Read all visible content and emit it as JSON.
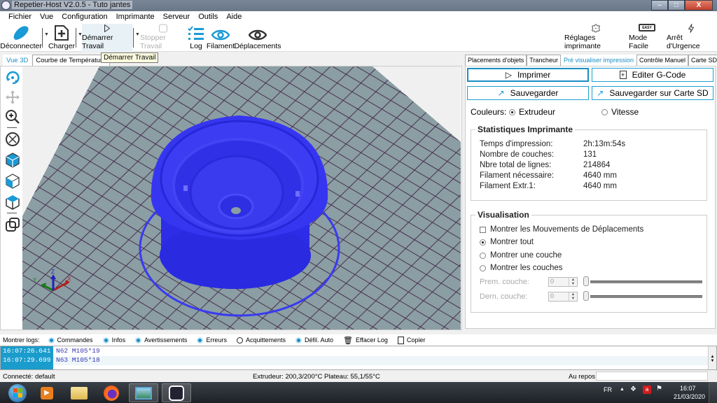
{
  "window": {
    "title": "Repetier-Host V2.0.5 - Tuto jantes",
    "controls": {
      "minimize": "–",
      "maximize": "□",
      "close": "X"
    }
  },
  "menu": [
    "Fichier",
    "Vue",
    "Configuration",
    "Imprimante",
    "Serveur",
    "Outils",
    "Aide"
  ],
  "toolbar": {
    "disconnect": "Déconnecter",
    "load": "Charger",
    "start_job": "Démarrer Travail",
    "stop_job": "Stopper Travail",
    "log": "Log",
    "filament": "Filament",
    "moves": "Déplacements",
    "printer_settings": "Réglages imprimante",
    "easy_mode": "Mode Facile",
    "easy_badge": "EASY",
    "emergency_stop": "Arrêt d'Urgence"
  },
  "tooltip": "Démarrer Travail",
  "left_tabs": [
    "Vue 3D",
    "Courbe de Température"
  ],
  "right_tabs": [
    "Placements d'objets",
    "Trancheur",
    "Pré visualiser impression",
    "Contrôle Manuel",
    "Carte SD"
  ],
  "preview": {
    "print_button": "Imprimer",
    "edit_gcode_button": "Editer G-Code",
    "save_button": "Sauvegarder",
    "save_sd_button": "Sauvegarder sur Carte SD",
    "colors_label": "Couleurs:",
    "color_options": [
      {
        "label": "Extrudeur",
        "selected": true
      },
      {
        "label": "Vitesse",
        "selected": false
      }
    ],
    "stats": {
      "title": "Statistiques Imprimante",
      "rows": [
        {
          "label": "Temps d'impression:",
          "value": "2h:13m:54s"
        },
        {
          "label": "Nombre de couches:",
          "value": "131"
        },
        {
          "label": "Nbre total de lignes:",
          "value": "214864"
        },
        {
          "label": "Filament nécessaire:",
          "value": "4640 mm"
        },
        {
          "label": "Filament Extr.1:",
          "value": "4640 mm"
        }
      ]
    },
    "visualisation": {
      "title": "Visualisation",
      "show_travel": {
        "label": "Montrer les Mouvements de Déplacements",
        "checked": false
      },
      "modes": [
        {
          "label": "Montrer tout",
          "selected": true
        },
        {
          "label": "Montrer une couche",
          "selected": false
        },
        {
          "label": "Montrer les couches",
          "selected": false
        }
      ],
      "first_layer": {
        "label": "Prem. couche:",
        "value": "0",
        "slider_fraction": 0
      },
      "last_layer": {
        "label": "Dern. couche:",
        "value": "0",
        "slider_fraction": 0
      }
    }
  },
  "viewport": {
    "object_color": "#3a3af0",
    "bed_color": "#8a9ea3",
    "axis_labels": {
      "x": "X",
      "y": "Y",
      "z": "Z"
    }
  },
  "log_options": {
    "label": "Montrer logs:",
    "items": [
      {
        "label": "Commandes",
        "on": true
      },
      {
        "label": "Infos",
        "on": true
      },
      {
        "label": "Avertissements",
        "on": true
      },
      {
        "label": "Erreurs",
        "on": true
      },
      {
        "label": "Acquittements",
        "on": false
      },
      {
        "label": "Défil. Auto",
        "on": true
      }
    ],
    "clear": "Effacer Log",
    "copy": "Copier"
  },
  "log_lines": [
    {
      "time": "16:07:26.641",
      "text": "N62 M105*19"
    },
    {
      "time": "16:07:29.699",
      "text": "N63 M105*18"
    }
  ],
  "status": {
    "connection": "Connecté: default",
    "temps": "Extrudeur: 200,3/200°C Plateau: 55,1/55°C",
    "state": "Au repos"
  },
  "taskbar": {
    "lang": "FR",
    "time": "16:07",
    "date": "21/03/2020"
  }
}
